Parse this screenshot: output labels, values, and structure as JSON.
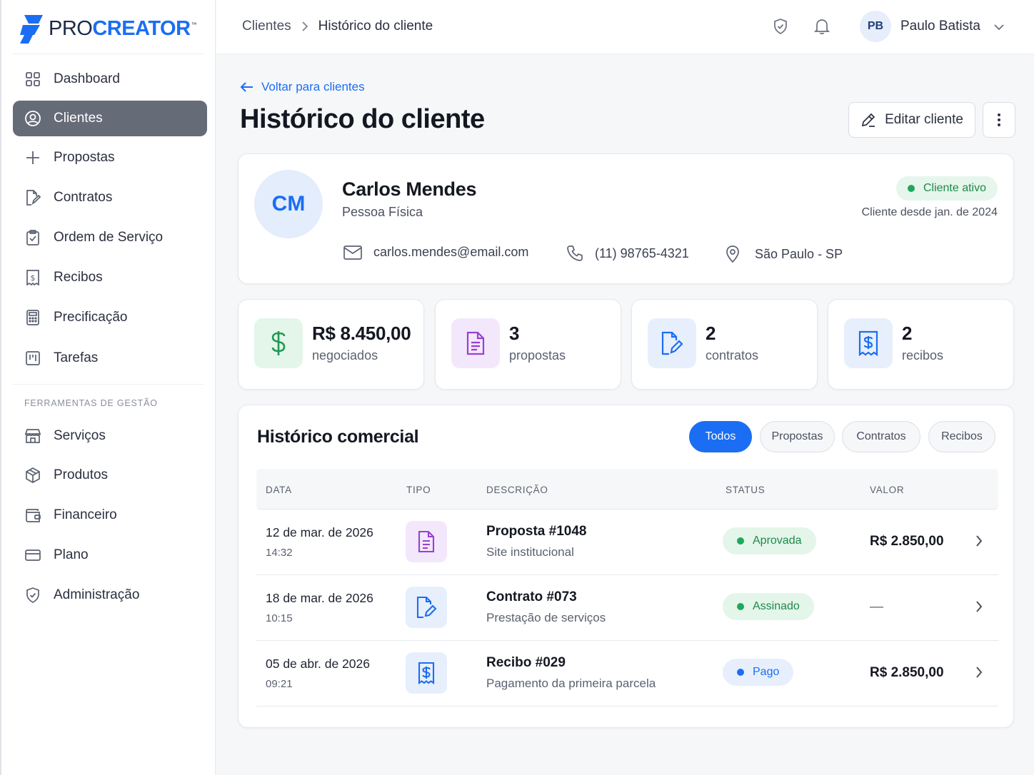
{
  "brand": {
    "part1": "PRO",
    "part2": "CREATOR",
    "tm": "™"
  },
  "sidebar": {
    "items": [
      {
        "label": "Dashboard",
        "icon": "grid-icon"
      },
      {
        "label": "Clientes",
        "icon": "user-circle-icon",
        "active": true
      },
      {
        "label": "Propostas",
        "icon": "plus-icon"
      },
      {
        "label": "Contratos",
        "icon": "document-edit-icon"
      },
      {
        "label": "Ordem de Serviço",
        "icon": "clipboard-icon"
      },
      {
        "label": "Recibos",
        "icon": "receipt-icon"
      },
      {
        "label": "Precificação",
        "icon": "calculator-icon"
      },
      {
        "label": "Tarefas",
        "icon": "kanban-icon"
      }
    ],
    "section_title": "FERRAMENTAS DE GESTÃO",
    "tools": [
      {
        "label": "Serviços",
        "icon": "store-icon"
      },
      {
        "label": "Produtos",
        "icon": "box-icon"
      },
      {
        "label": "Financeiro",
        "icon": "wallet-icon"
      },
      {
        "label": "Plano",
        "icon": "credit-card-icon"
      },
      {
        "label": "Administração",
        "icon": "shield-check-icon"
      }
    ]
  },
  "topbar": {
    "breadcrumb": [
      "Clientes",
      "Histórico do cliente"
    ],
    "user_initials": "PB",
    "user_name": "Paulo Batista"
  },
  "page": {
    "back_label": "Voltar para clientes",
    "title": "Histórico do cliente",
    "edit_label": "Editar cliente"
  },
  "client": {
    "initials": "CM",
    "name": "Carlos Mendes",
    "type": "Pessoa Física",
    "status": "Cliente ativo",
    "since": "Cliente desde jan. de 2024",
    "email": "carlos.mendes@email.com",
    "phone": "(11) 98765-4321",
    "location": "São Paulo - SP"
  },
  "stats": [
    {
      "value": "R$ 8.450,00",
      "label": "negociados",
      "icon": "dollar-icon"
    },
    {
      "value": "3",
      "label": "propostas",
      "icon": "document-icon"
    },
    {
      "value": "2",
      "label": "contratos",
      "icon": "document-edit-icon"
    },
    {
      "value": "2",
      "label": "recibos",
      "icon": "receipt-icon"
    }
  ],
  "history": {
    "title": "Histórico comercial",
    "filters": [
      "Todos",
      "Propostas",
      "Contratos",
      "Recibos"
    ],
    "active_filter": "Todos",
    "columns": [
      "DATA",
      "TIPO",
      "DESCRIÇÃO",
      "STATUS",
      "VALOR"
    ],
    "rows": [
      {
        "date": "12 de mar. de 2026",
        "time": "14:32",
        "type_icon": "document-icon",
        "title": "Proposta #1048",
        "subtitle": "Site institucional",
        "status": "Aprovada",
        "value": "R$ 2.850,00"
      },
      {
        "date": "18 de mar. de 2026",
        "time": "10:15",
        "type_icon": "document-edit-icon",
        "title": "Contrato #073",
        "subtitle": "Prestação de serviços",
        "status": "Assinado",
        "value": "—"
      },
      {
        "date": "05 de abr. de 2026",
        "time": "09:21",
        "type_icon": "receipt-icon",
        "title": "Recibo #029",
        "subtitle": "Pagamento da primeira parcela",
        "status": "Pago",
        "value": "R$ 2.850,00"
      }
    ]
  },
  "colors": {
    "accent": "#1b6ef3",
    "sidebar_active": "#666b78",
    "green": "#1e8a4a",
    "purple": "#9a3fd6"
  }
}
